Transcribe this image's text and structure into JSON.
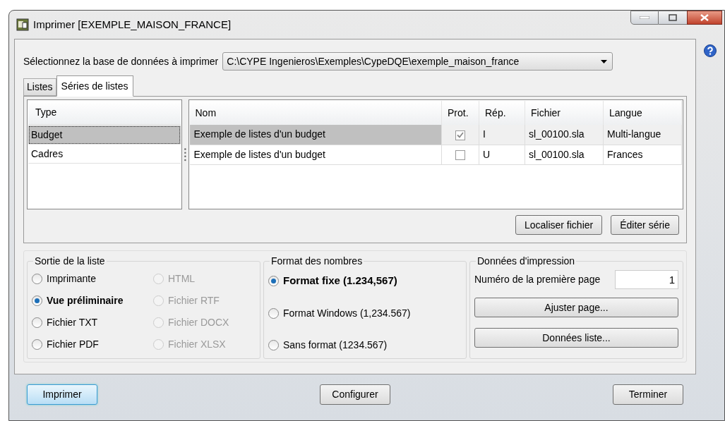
{
  "window": {
    "title": "Imprimer [EXEMPLE_MAISON_FRANCE]"
  },
  "database": {
    "label": "Sélectionnez la base de données à imprimer",
    "value": "C:\\CYPE Ingenieros\\Exemples\\CypeDQE\\exemple_maison_france"
  },
  "tabs": [
    {
      "label": "Listes",
      "selected": false
    },
    {
      "label": "Séries de listes",
      "selected": true
    }
  ],
  "type_list": {
    "header": "Type",
    "items": [
      {
        "label": "Budget",
        "selected": true
      },
      {
        "label": "Cadres",
        "selected": false
      }
    ]
  },
  "series_table": {
    "columns": [
      "Nom",
      "Prot.",
      "Rép.",
      "Fichier",
      "Langue"
    ],
    "rows": [
      {
        "nom": "Exemple de listes d'un budget",
        "checked": true,
        "rep": "I",
        "fichier": "sl_00100.sla",
        "langue": "Multi-langue",
        "selected": true
      },
      {
        "nom": "Exemple de listes d'un budget",
        "checked": false,
        "rep": "U",
        "fichier": "sl_00100.sla",
        "langue": "Frances",
        "selected": false
      }
    ]
  },
  "series_buttons": [
    "Localiser fichier",
    "Éditer série"
  ],
  "output": {
    "title": "Sortie de la liste",
    "options": [
      {
        "label": "Imprimante",
        "selected": false,
        "disabled": false
      },
      {
        "label": "Vue préliminaire",
        "selected": true,
        "disabled": false
      },
      {
        "label": "Fichier TXT",
        "selected": false,
        "disabled": false
      },
      {
        "label": "Fichier PDF",
        "selected": false,
        "disabled": false
      },
      {
        "label": "HTML",
        "selected": false,
        "disabled": true
      },
      {
        "label": "Fichier RTF",
        "selected": false,
        "disabled": true
      },
      {
        "label": "Fichier DOCX",
        "selected": false,
        "disabled": true
      },
      {
        "label": "Fichier XLSX",
        "selected": false,
        "disabled": true
      }
    ]
  },
  "number_format": {
    "title": "Format des nombres",
    "options": [
      {
        "label": "Format fixe (1.234,567)",
        "selected": true
      },
      {
        "label": "Format Windows (1,234.567)",
        "selected": false
      },
      {
        "label": "Sans format (1234.567)",
        "selected": false
      }
    ]
  },
  "print_data": {
    "title": "Données d'impression",
    "first_page_label": "Numéro de la première page",
    "first_page_value": "1",
    "buttons": [
      "Ajuster page...",
      "Données liste..."
    ]
  },
  "footer_buttons": [
    {
      "label": "Imprimer",
      "default": true
    },
    {
      "label": "Configurer",
      "default": false
    },
    {
      "label": "Terminer",
      "default": false
    }
  ]
}
